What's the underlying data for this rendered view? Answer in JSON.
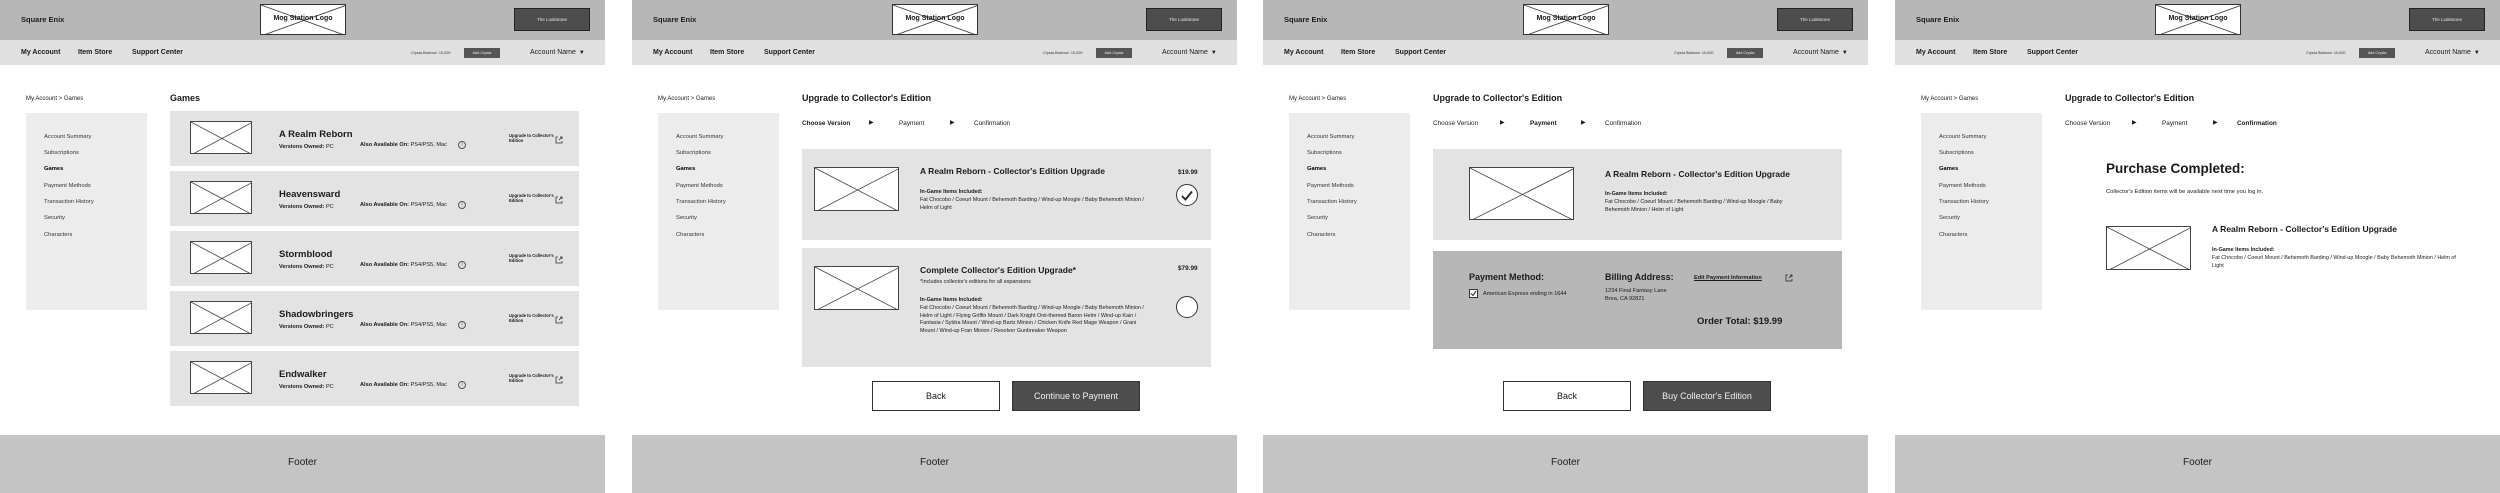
{
  "header": {
    "brand": "Square Enix",
    "logo": "Mog Station Logo",
    "lodestone": "The Lodestone"
  },
  "nav": {
    "links": [
      "My Account",
      "Item Store",
      "Support Center"
    ],
    "crysta_balance": "Crysta Balance: 10,000",
    "add_crysta": "Add Crysta",
    "account_name": "Account Name"
  },
  "breadcrumb": "My Account > Games",
  "sidebar": {
    "items": [
      "Account Summary",
      "Subscriptions",
      "Games",
      "Payment Methods",
      "Transaction History",
      "Security",
      "Characters"
    ],
    "active": "Games"
  },
  "games_page": {
    "title": "Games",
    "versions_owned_label": "Versions Owned:",
    "also_available_label": "Also Available On:",
    "upgrade_label": "Upgrade to Collector's Edition",
    "games": [
      {
        "name": "A Realm Reborn",
        "owned": "PC",
        "available": "PS4/PS5, Mac"
      },
      {
        "name": "Heavensward",
        "owned": "PC",
        "available": "PS4/PS5, Mac"
      },
      {
        "name": "Stormblood",
        "owned": "PC",
        "available": "PS4/PS5, Mac"
      },
      {
        "name": "Shadowbringers",
        "owned": "PC",
        "available": "PS4/PS5, Mac"
      },
      {
        "name": "Endwalker",
        "owned": "PC",
        "available": "PS4/PS5, Mac"
      }
    ]
  },
  "upgrade": {
    "title": "Upgrade to Collector's Edition",
    "steps": [
      "Choose Version",
      "Payment",
      "Confirmation"
    ],
    "included_label": "In-Game Items Included:",
    "option1": {
      "name": "A Realm Reborn - Collector's Edition Upgrade",
      "price": "$19.99",
      "items": "Fat Chocobo / Coeurl Mount / Behemoth Barding / Wind-up Moogle / Baby Behemoth Minion / Helm of Light"
    },
    "option2": {
      "name": "Complete Collector's Edition Upgrade*",
      "note": "*Includes collector's editions for all expansions",
      "price": "$79.99",
      "items": "Fat Chocobo / Coeurl Mount / Behemoth Barding / Wind-up Moogle / Baby Behemoth Minion / Helm of Light / Flying Griffin Mount / Dark Knight Onii-themed Baron Helm / Wind-up Kain / Fantasia / Syldra Mount / Wind-up Bartz Minion / Chicken Knife Red Mage Weapon / Grani Mount / Wind-up Fran Minion / Resolver Gunbreaker Weapon"
    },
    "back": "Back",
    "continue": "Continue to Payment"
  },
  "payment": {
    "method_title": "Payment Method:",
    "card": "American Express ending in 1644",
    "billing_title": "Billing Address:",
    "address_line1": "1234 Final Fantasy Lane",
    "address_line2": "Brea, CA 92821",
    "edit": "Edit Payment Information",
    "order_total": "Order Total: $19.99",
    "buy": "Buy Collector's Edition"
  },
  "completed": {
    "title": "Purchase Completed:",
    "subtitle": "Collector's Edition items will be available next time you log in."
  },
  "footer": "Footer"
}
